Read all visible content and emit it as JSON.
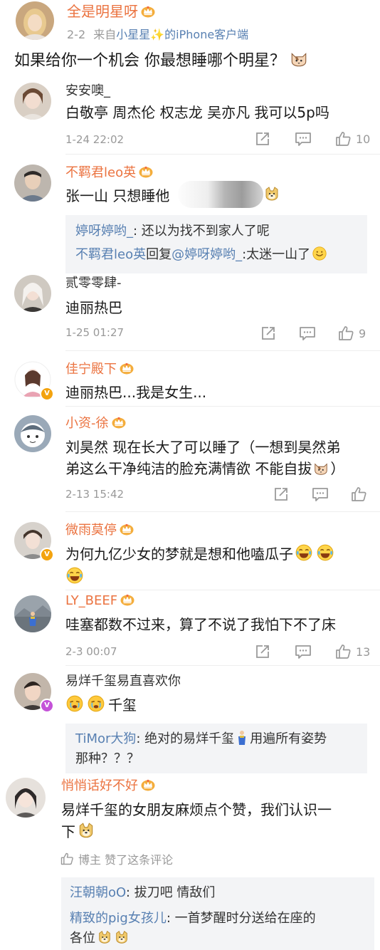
{
  "post": {
    "author": "全是明星呀",
    "time": "2-2",
    "source_prefix": "来自",
    "source": "小星星✨的iPhone客户端",
    "content": "如果给你一个机会 你最想睡哪个明星？"
  },
  "comments": [
    {
      "user": "安安噢_",
      "text": "白敬亭 周杰伦 权志龙 吴亦凡 我可以5p吗",
      "time": "1-24 22:02",
      "likes": "10"
    },
    {
      "user": "不羁君leo英",
      "text": "张一山 只想睡他",
      "replies": [
        {
          "user": "婷呀婷哟_",
          "text": ": 还以为找不到家人了呢"
        },
        {
          "user": "不羁君leo英",
          "mid": "回复",
          "target": "@婷呀婷哟_",
          "text": ":太迷一山了"
        }
      ]
    },
    {
      "user": "贰零零肆-",
      "text": "迪丽热巴",
      "time": "1-25 01:27",
      "likes": "9"
    },
    {
      "user": "佳宁殿下",
      "text": "迪丽热巴...我是女生..."
    },
    {
      "user": "小资-徐",
      "text_lines": [
        "刘昊然 现在长大了可以睡了（一想到昊然弟",
        "弟这么干净纯洁的脸充满情欲 不能自拔"
      ],
      "text_end": "）",
      "time": "2-13 15:42"
    },
    {
      "user": "微雨莫停",
      "text": "为何九亿少女的梦就是想和他嗑瓜子"
    },
    {
      "user": "LY_BEEF",
      "text": "哇塞都数不过来，算了不说了我怕下不了床",
      "time": "2-3 00:07",
      "likes": "13"
    },
    {
      "user": "易烊千玺易直喜欢你",
      "text": "千玺",
      "replies": [
        {
          "user": "TiMor大狗",
          "text": ": 绝对的易烊千玺",
          "text2": "用遍所有姿势",
          "text3": "那种？？？"
        }
      ]
    },
    {
      "user": "悄悄话好不好",
      "text_lines": [
        "易烊千玺的女朋友麻烦点个赞，我们认识一",
        "下"
      ],
      "liked_by": "博主 赞了这条评论",
      "replies": [
        {
          "user": "汪朝朝oO",
          "text": ": 拔刀吧  情敌们"
        },
        {
          "user": "精致的pig女孩儿",
          "text": ": 一首梦醒时分送给在座的",
          "text2": "各位"
        }
      ]
    }
  ],
  "icons": {
    "share": "share-icon",
    "comment": "comment-icon",
    "like": "thumbs-up-icon",
    "crown": "crown-vip-icon",
    "verified": "verified-badge-icon"
  },
  "colors": {
    "username_vip": "#eb7340",
    "link_blue": "#5880b2",
    "meta_grey": "#999999",
    "reply_bg": "#f3f4f6",
    "verified_badge": "#f3a30f"
  }
}
